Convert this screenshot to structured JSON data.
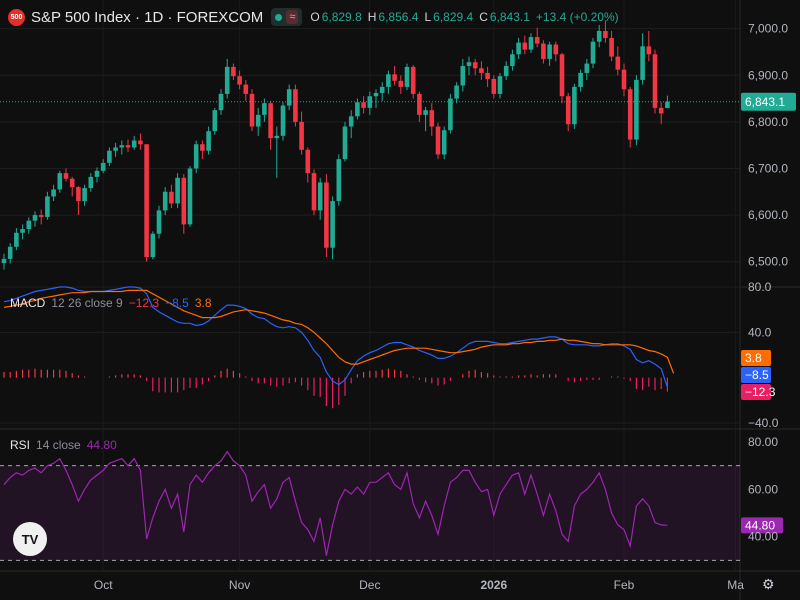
{
  "header": {
    "logo_text": "500",
    "title": "S&P 500 Index · 1D · FOREXCOM",
    "ohlc": [
      {
        "key": "O",
        "value": "6,829.8"
      },
      {
        "key": "H",
        "value": "6,856.4"
      },
      {
        "key": "L",
        "value": "6,829.4"
      },
      {
        "key": "C",
        "value": "6,843.1"
      }
    ],
    "change": "+13.4 (+0.20%)"
  },
  "colors": {
    "up": "#22ab94",
    "down": "#f23645",
    "macd": "#2962ff",
    "signal": "#ff6d00",
    "rsi": "#9c27b0",
    "background": "#0f0f0f"
  },
  "chart_data": [
    {
      "type": "candlestick",
      "title": "S&P 500 Index · 1D · FOREXCOM",
      "last_price": 6843.1,
      "last_price_label": "6,843.1",
      "ylim": [
        6450,
        7040
      ],
      "y_ticks": [
        "7,000.0",
        "6,900.0",
        "6,800.0",
        "6,700.0",
        "6,600.0",
        "6,500.0"
      ],
      "x_ticks": [
        "Oct",
        "Nov",
        "Dec",
        "2026",
        "Feb",
        "Ma"
      ],
      "candles": [
        [
          6497,
          6517,
          6483,
          6506
        ],
        [
          6506,
          6540,
          6496,
          6532
        ],
        [
          6532,
          6572,
          6525,
          6562
        ],
        [
          6562,
          6580,
          6548,
          6570
        ],
        [
          6570,
          6595,
          6560,
          6588
        ],
        [
          6588,
          6608,
          6575,
          6600
        ],
        [
          6600,
          6612,
          6580,
          6596
        ],
        [
          6596,
          6650,
          6590,
          6640
        ],
        [
          6640,
          6665,
          6630,
          6655
        ],
        [
          6655,
          6695,
          6648,
          6690
        ],
        [
          6690,
          6700,
          6672,
          6678
        ],
        [
          6678,
          6682,
          6640,
          6660
        ],
        [
          6660,
          6662,
          6600,
          6630
        ],
        [
          6630,
          6665,
          6620,
          6658
        ],
        [
          6658,
          6690,
          6650,
          6682
        ],
        [
          6682,
          6702,
          6670,
          6695
        ],
        [
          6695,
          6720,
          6690,
          6712
        ],
        [
          6712,
          6745,
          6705,
          6738
        ],
        [
          6738,
          6755,
          6725,
          6745
        ],
        [
          6745,
          6760,
          6730,
          6750
        ],
        [
          6750,
          6762,
          6735,
          6745
        ],
        [
          6745,
          6770,
          6740,
          6760
        ],
        [
          6760,
          6775,
          6740,
          6752
        ],
        [
          6752,
          6752,
          6500,
          6510
        ],
        [
          6510,
          6565,
          6505,
          6560
        ],
        [
          6560,
          6620,
          6550,
          6610
        ],
        [
          6610,
          6660,
          6600,
          6650
        ],
        [
          6650,
          6665,
          6615,
          6625
        ],
        [
          6625,
          6690,
          6615,
          6680
        ],
        [
          6680,
          6688,
          6560,
          6580
        ],
        [
          6580,
          6705,
          6575,
          6700
        ],
        [
          6700,
          6760,
          6690,
          6752
        ],
        [
          6752,
          6760,
          6720,
          6738
        ],
        [
          6738,
          6790,
          6730,
          6780
        ],
        [
          6780,
          6830,
          6772,
          6825
        ],
        [
          6825,
          6870,
          6815,
          6860
        ],
        [
          6860,
          6935,
          6850,
          6918
        ],
        [
          6918,
          6925,
          6890,
          6898
        ],
        [
          6898,
          6910,
          6870,
          6880
        ],
        [
          6880,
          6890,
          6845,
          6860
        ],
        [
          6860,
          6870,
          6780,
          6790
        ],
        [
          6790,
          6830,
          6770,
          6815
        ],
        [
          6815,
          6850,
          6800,
          6840
        ],
        [
          6840,
          6845,
          6740,
          6765
        ],
        [
          6765,
          6790,
          6680,
          6770
        ],
        [
          6770,
          6842,
          6760,
          6835
        ],
        [
          6835,
          6880,
          6825,
          6870
        ],
        [
          6870,
          6880,
          6790,
          6800
        ],
        [
          6800,
          6822,
          6730,
          6740
        ],
        [
          6740,
          6745,
          6670,
          6690
        ],
        [
          6690,
          6698,
          6600,
          6610
        ],
        [
          6610,
          6680,
          6590,
          6670
        ],
        [
          6670,
          6688,
          6510,
          6530
        ],
        [
          6530,
          6640,
          6505,
          6630
        ],
        [
          6630,
          6730,
          6620,
          6720
        ],
        [
          6720,
          6800,
          6715,
          6790
        ],
        [
          6790,
          6825,
          6765,
          6812
        ],
        [
          6812,
          6850,
          6805,
          6842
        ],
        [
          6842,
          6855,
          6818,
          6830
        ],
        [
          6830,
          6865,
          6815,
          6855
        ],
        [
          6855,
          6870,
          6830,
          6862
        ],
        [
          6862,
          6885,
          6845,
          6875
        ],
        [
          6875,
          6910,
          6860,
          6902
        ],
        [
          6902,
          6920,
          6878,
          6888
        ],
        [
          6888,
          6900,
          6860,
          6875
        ],
        [
          6875,
          6925,
          6868,
          6918
        ],
        [
          6918,
          6922,
          6850,
          6860
        ],
        [
          6860,
          6865,
          6800,
          6815
        ],
        [
          6815,
          6832,
          6780,
          6825
        ],
        [
          6825,
          6840,
          6770,
          6790
        ],
        [
          6790,
          6798,
          6720,
          6730
        ],
        [
          6730,
          6790,
          6720,
          6782
        ],
        [
          6782,
          6860,
          6775,
          6850
        ],
        [
          6850,
          6885,
          6840,
          6878
        ],
        [
          6878,
          6935,
          6865,
          6920
        ],
        [
          6920,
          6940,
          6900,
          6928
        ],
        [
          6928,
          6935,
          6900,
          6915
        ],
        [
          6915,
          6930,
          6890,
          6905
        ],
        [
          6905,
          6918,
          6875,
          6892
        ],
        [
          6892,
          6900,
          6850,
          6860
        ],
        [
          6860,
          6905,
          6850,
          6898
        ],
        [
          6898,
          6930,
          6890,
          6920
        ],
        [
          6920,
          6955,
          6910,
          6945
        ],
        [
          6945,
          6980,
          6935,
          6970
        ],
        [
          6970,
          6985,
          6945,
          6955
        ],
        [
          6955,
          6990,
          6948,
          6982
        ],
        [
          6982,
          7002,
          6960,
          6968
        ],
        [
          6968,
          6975,
          6925,
          6935
        ],
        [
          6935,
          6972,
          6920,
          6966
        ],
        [
          6966,
          6972,
          6930,
          6945
        ],
        [
          6945,
          6948,
          6840,
          6855
        ],
        [
          6855,
          6862,
          6780,
          6795
        ],
        [
          6795,
          6882,
          6785,
          6875
        ],
        [
          6875,
          6912,
          6865,
          6905
        ],
        [
          6905,
          6935,
          6890,
          6925
        ],
        [
          6925,
          6980,
          6915,
          6972
        ],
        [
          6972,
          7008,
          6960,
          6995
        ],
        [
          6995,
          7018,
          6970,
          6980
        ],
        [
          6980,
          6995,
          6930,
          6940
        ],
        [
          6940,
          6962,
          6900,
          6912
        ],
        [
          6912,
          6925,
          6855,
          6870
        ],
        [
          6870,
          6875,
          6745,
          6762
        ],
        [
          6762,
          6900,
          6750,
          6890
        ],
        [
          6890,
          6990,
          6880,
          6962
        ],
        [
          6962,
          6995,
          6930,
          6945
        ],
        [
          6945,
          6955,
          6818,
          6830
        ],
        [
          6830,
          6842,
          6795,
          6818
        ],
        [
          6829.8,
          6856.4,
          6829.4,
          6843.1
        ]
      ]
    },
    {
      "type": "line",
      "title": "MACD",
      "params": "12 26 close 9",
      "labels": {
        "histogram": "−12.3",
        "macd": "−8.5",
        "signal": "3.8"
      },
      "ylim": [
        -40,
        80
      ],
      "y_ticks": [
        "80.0",
        "40.0",
        "−40.0"
      ],
      "series": [
        {
          "name": "MACD",
          "values": [
            67,
            68,
            70,
            72,
            74,
            76,
            77,
            78,
            79,
            80,
            80,
            79,
            77,
            76,
            76,
            76,
            76,
            77,
            78,
            79,
            80,
            80,
            79,
            74,
            62,
            58,
            55,
            52,
            49,
            48,
            48,
            46,
            47,
            50,
            55,
            60,
            64,
            64,
            63,
            61,
            56,
            53,
            52,
            48,
            45,
            44,
            45,
            44,
            40,
            33,
            24,
            18,
            5,
            -3,
            -6,
            -2,
            7,
            15,
            19,
            22,
            24,
            27,
            30,
            31,
            31,
            29,
            27,
            24,
            22,
            20,
            17,
            17,
            19,
            22,
            26,
            30,
            32,
            32,
            32,
            31,
            30,
            30,
            31,
            32,
            33,
            34,
            34,
            35,
            36,
            36,
            34,
            30,
            29,
            29,
            29,
            28,
            28,
            29,
            30,
            30,
            28,
            25,
            16,
            13,
            15,
            12,
            8,
            -8.5
          ]
        },
        {
          "name": "Signal",
          "values": [
            62,
            63,
            64,
            65,
            67,
            68,
            70,
            71,
            72,
            73,
            74,
            75,
            75,
            75,
            76,
            76,
            76,
            76,
            76,
            76,
            77,
            77,
            77,
            77,
            74,
            71,
            68,
            65,
            62,
            59,
            57,
            55,
            53,
            53,
            53,
            54,
            56,
            58,
            59,
            60,
            59,
            58,
            57,
            55,
            53,
            51,
            50,
            48,
            47,
            44,
            40,
            35,
            30,
            24,
            18,
            14,
            12,
            12,
            14,
            16,
            18,
            20,
            22,
            24,
            25,
            26,
            26,
            26,
            26,
            25,
            24,
            23,
            22,
            22,
            23,
            24,
            25,
            27,
            28,
            29,
            29,
            29,
            30,
            30,
            31,
            31,
            32,
            32,
            33,
            33,
            34,
            33,
            33,
            32,
            31,
            30,
            30,
            29,
            29,
            29,
            29,
            29,
            28,
            26,
            24,
            23,
            21,
            18,
            3.8
          ]
        },
        {
          "name": "Histogram",
          "values": [
            5,
            5,
            6,
            7,
            7,
            8,
            7,
            7,
            7,
            7,
            6,
            4,
            2,
            1,
            0,
            0,
            0,
            1,
            2,
            3,
            3,
            3,
            2,
            -3,
            -12,
            -13,
            -13,
            -13,
            -13,
            -11,
            -9,
            -9,
            -6,
            -3,
            2,
            6,
            8,
            6,
            4,
            1,
            -3,
            -5,
            -5,
            -7,
            -8,
            -7,
            -5,
            -4,
            -7,
            -11,
            -16,
            -17,
            -25,
            -27,
            -24,
            -16,
            -5,
            3,
            5,
            6,
            6,
            7,
            8,
            7,
            6,
            3,
            1,
            -2,
            -4,
            -5,
            -7,
            -6,
            -3,
            0,
            3,
            6,
            7,
            5,
            4,
            2,
            1,
            1,
            1,
            2,
            2,
            3,
            2,
            3,
            3,
            3,
            0,
            -3,
            -4,
            -3,
            -2,
            -2,
            -2,
            0,
            1,
            1,
            -1,
            -3,
            -10,
            -11,
            -8,
            -11,
            -10,
            -12.3
          ]
        }
      ]
    },
    {
      "type": "line",
      "title": "RSI",
      "params": "14 close",
      "value_label": "44.80",
      "ylim": [
        30,
        80
      ],
      "y_ticks": [
        "80.00",
        "60.00",
        "40.00"
      ],
      "bands": [
        70,
        30
      ],
      "series": [
        {
          "name": "RSI",
          "values": [
            62,
            65,
            67,
            66,
            68,
            69,
            67,
            70,
            71,
            73,
            68,
            62,
            55,
            60,
            64,
            66,
            68,
            71,
            72,
            73,
            70,
            73,
            68,
            39,
            48,
            55,
            60,
            52,
            58,
            42,
            62,
            66,
            63,
            67,
            70,
            72,
            76,
            72,
            70,
            66,
            55,
            59,
            62,
            52,
            56,
            63,
            65,
            55,
            46,
            43,
            38,
            48,
            32,
            45,
            55,
            60,
            58,
            61,
            58,
            63,
            63,
            65,
            67,
            62,
            60,
            67,
            54,
            48,
            55,
            49,
            41,
            53,
            63,
            65,
            68,
            68,
            63,
            59,
            60,
            49,
            58,
            62,
            66,
            67,
            58,
            66,
            58,
            49,
            58,
            51,
            41,
            38,
            53,
            58,
            60,
            63,
            67,
            60,
            50,
            45,
            43,
            36,
            53,
            56,
            53,
            46,
            45,
            44.8
          ]
        }
      ]
    }
  ],
  "indicators": {
    "macd": {
      "name": "MACD",
      "params": "12 26 close 9",
      "hist": "−12.3",
      "macd": "−8.5",
      "signal": "3.8"
    },
    "rsi": {
      "name": "RSI",
      "params": "14 close",
      "value": "44.80"
    }
  },
  "icons": {
    "tradingview": "tv-logo-icon",
    "settings": "gear-icon"
  }
}
